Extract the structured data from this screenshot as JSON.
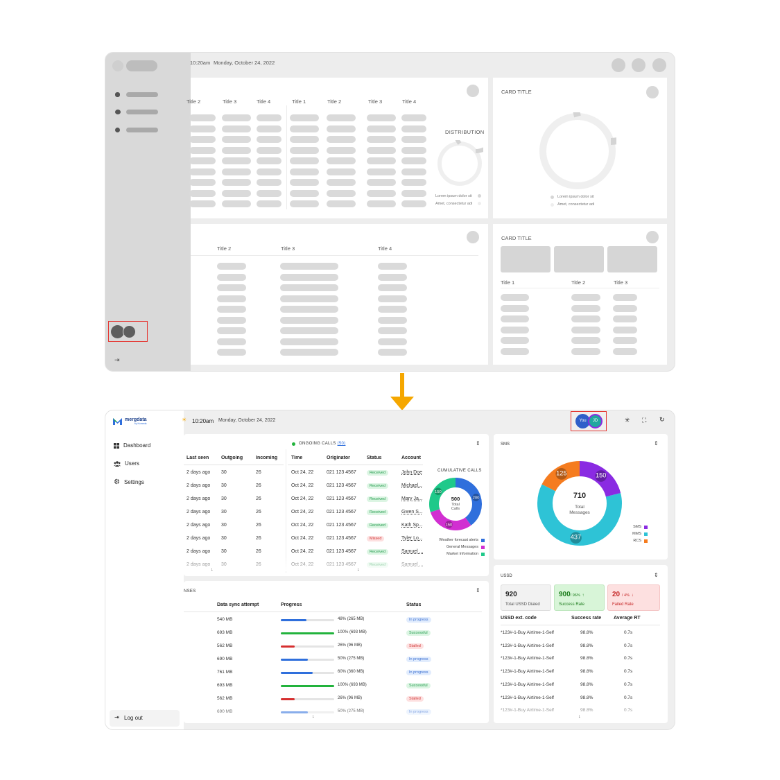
{
  "colors": {
    "accent": "#f5a700",
    "highlight": "#e53935",
    "green": "#22b33c",
    "red": "#d62f2f",
    "blue": "#2f6fdc",
    "purple": "#8a2be2",
    "cyan": "#2ec3d6",
    "orange": "#f57c1f",
    "pink": "#d12fd1",
    "teal": "#1fc98a"
  },
  "wire": {
    "time": "10:20am",
    "date": "Monday, October 24, 2022",
    "card1": {
      "titles_a": [
        "Title 2",
        "Title 3",
        "Title 4"
      ],
      "titles_b": [
        "Title 1",
        "Title 2",
        "Title 3",
        "Title 4"
      ],
      "distribution": "DISTRIBUTION",
      "legend": [
        "Lorem ipsum dolor sit",
        "Amet, consectetur adi"
      ]
    },
    "card2": {
      "title": "CARD TITLE",
      "legend": [
        "Lorem ipsum dolor sit",
        "Amet, consectetur adi"
      ]
    },
    "card3": {
      "titles": [
        "Title 2",
        "Title 3",
        "Title 4"
      ]
    },
    "card4": {
      "title": "CARD TITLE",
      "titles": [
        "Title 1",
        "Title 2",
        "Title 3"
      ]
    }
  },
  "app": {
    "brand": "mergdata",
    "brand_sub": "by Komeda",
    "time": "10:20am",
    "date": "Monday, October 24, 2022",
    "avatars": [
      "You",
      "JD"
    ],
    "nav": [
      {
        "label": "Dashboard",
        "icon": "grid-icon"
      },
      {
        "label": "Users",
        "icon": "users-icon"
      },
      {
        "label": "Settings",
        "icon": "gear-icon"
      }
    ],
    "logout": "Log out",
    "users_table": {
      "headers": [
        "Last seen",
        "Outgoing",
        "Incoming"
      ],
      "rows": [
        [
          "2 days ago",
          "30",
          "26"
        ],
        [
          "2 days ago",
          "30",
          "26"
        ],
        [
          "2 days ago",
          "30",
          "26"
        ],
        [
          "2 days ago",
          "30",
          "26"
        ],
        [
          "2 days ago",
          "30",
          "26"
        ],
        [
          "2 days ago",
          "30",
          "26"
        ],
        [
          "2 days ago",
          "30",
          "26"
        ],
        [
          "2 days ago",
          "30",
          "26"
        ]
      ]
    },
    "calls": {
      "title": "ONGOING CALLS",
      "count": "(50)",
      "headers": [
        "Time",
        "Originator",
        "Status",
        "Account"
      ],
      "rows": [
        [
          "Oct 24, 22",
          "021 123 4567",
          "Received",
          "John Doe"
        ],
        [
          "Oct 24, 22",
          "021 123 4567",
          "Received",
          "Michael..."
        ],
        [
          "Oct 24, 22",
          "021 123 4567",
          "Received",
          "Mary Ja..."
        ],
        [
          "Oct 24, 22",
          "021 123 4567",
          "Received",
          "Gwen S..."
        ],
        [
          "Oct 24, 22",
          "021 123 4567",
          "Received",
          "Kath Sp..."
        ],
        [
          "Oct 24, 22",
          "021 123 4567",
          "Missed",
          "Tyler Lo..."
        ],
        [
          "Oct 24, 22",
          "021 123 4567",
          "Received",
          "Samuel ..."
        ],
        [
          "Oct 24, 22",
          "021 123 4567",
          "Received",
          "Samuel ..."
        ]
      ],
      "cumulative_title": "CUMULATIVE CALLS",
      "total": "500",
      "total_label": "Total Calls",
      "legend": [
        "Weather forecast alerts",
        "General Messages",
        "Market Information"
      ]
    },
    "sync": {
      "title": "NSES",
      "headers": [
        "Data sync attempt",
        "Progress",
        "Status"
      ],
      "rows": [
        [
          "540 MB",
          "48%",
          "(265 MB)",
          "In progress"
        ],
        [
          "693 MB",
          "100%",
          "(693 MB)",
          "Successful"
        ],
        [
          "562 MB",
          "26%",
          "(96 MB)",
          "Stalled"
        ],
        [
          "690 MB",
          "50%",
          "(275 MB)",
          "In progress"
        ],
        [
          "761 MB",
          "60%",
          "(360 MB)",
          "In progress"
        ],
        [
          "693 MB",
          "100%",
          "(693 MB)",
          "Successful"
        ],
        [
          "562 MB",
          "26%",
          "(96 MB)",
          "Stalled"
        ],
        [
          "690 MB",
          "50%",
          "(275 MB)",
          "In progress"
        ]
      ]
    },
    "sms": {
      "title": "SMS",
      "total": "710",
      "total_label": "Total Messages",
      "legend": [
        "SMS",
        "MMS",
        "RCS"
      ]
    },
    "ussd": {
      "title": "USSD",
      "stats": [
        {
          "value": "920",
          "pct": "",
          "label": "Total USSD Dialed"
        },
        {
          "value": "900",
          "pct": "/ 96%",
          "arrow": "↑",
          "label": "Success Rate"
        },
        {
          "value": "20",
          "pct": "/ 4%",
          "arrow": "↓",
          "label": "Failed Rate"
        }
      ],
      "headers": [
        "USSD ext. code",
        "Success rate",
        "Average RT"
      ],
      "rows": [
        [
          "*123#-1-Buy Airtime-1-Self",
          "98.8%",
          "0.7s"
        ],
        [
          "*123#-1-Buy Airtime-1-Self",
          "98.8%",
          "0.7s"
        ],
        [
          "*123#-1-Buy Airtime-1-Self",
          "98.8%",
          "0.7s"
        ],
        [
          "*123#-1-Buy Airtime-1-Self",
          "98.8%",
          "0.7s"
        ],
        [
          "*123#-1-Buy Airtime-1-Self",
          "98.8%",
          "0.7s"
        ],
        [
          "*123#-1-Buy Airtime-1-Self",
          "98.8%",
          "0.7s"
        ],
        [
          "*123#-1-Buy Airtime-1-Self",
          "98.8%",
          "0.7s"
        ]
      ]
    }
  },
  "chart_data": [
    {
      "type": "pie",
      "title": "CUMULATIVE CALLS",
      "categories": [
        "Weather forecast alerts",
        "General Messages",
        "Market Information"
      ],
      "values": [
        200,
        150,
        150
      ],
      "colors": [
        "#2f6fdc",
        "#d12fd1",
        "#1fc98a"
      ]
    },
    {
      "type": "pie",
      "title": "SMS",
      "categories": [
        "SMS",
        "MMS",
        "RCS"
      ],
      "values": [
        150,
        437,
        125
      ],
      "colors": [
        "#8a2be2",
        "#2ec3d6",
        "#f57c1f"
      ]
    }
  ]
}
